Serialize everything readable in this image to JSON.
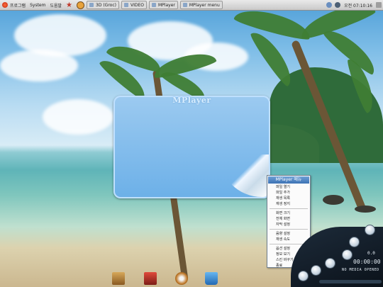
{
  "panel": {
    "apps_label": "프로그램",
    "system_label": "System",
    "help_label": "도움말",
    "tasks": [
      {
        "label": "3D (Groc)"
      },
      {
        "label": "VIDEO"
      },
      {
        "label": "MPlayer"
      },
      {
        "label": "MPlayer menu"
      }
    ],
    "clock": "오전 07:10:16"
  },
  "mplayer": {
    "title": "MPlayer"
  },
  "context_menu": {
    "header": "MPlayer 메뉴",
    "groups": [
      [
        "파일 열기",
        "파일 추가",
        "재생 목록",
        "재생 정지"
      ],
      [
        "화면 크기",
        "전체 화면",
        "자막 설정"
      ],
      [
        "음향 설정",
        "재생 속도"
      ],
      [
        "옵션 설정",
        "정보 보기",
        "스킨 바꾸기",
        "종료"
      ]
    ]
  },
  "controls": {
    "time": "00:00:00",
    "status": "NO MEDIA OPENED",
    "volume": "0.0"
  },
  "desktop_icons": [
    {
      "name": "home-folder-icon"
    },
    {
      "name": "cd-icon"
    },
    {
      "name": "disk-icon"
    },
    {
      "name": "trash-icon"
    }
  ],
  "colors": {
    "panel_bg": "#d8d8d8",
    "mplayer_blue": "#7ab8ec",
    "menu_header": "#4f84c4",
    "control_dark": "#101820"
  }
}
